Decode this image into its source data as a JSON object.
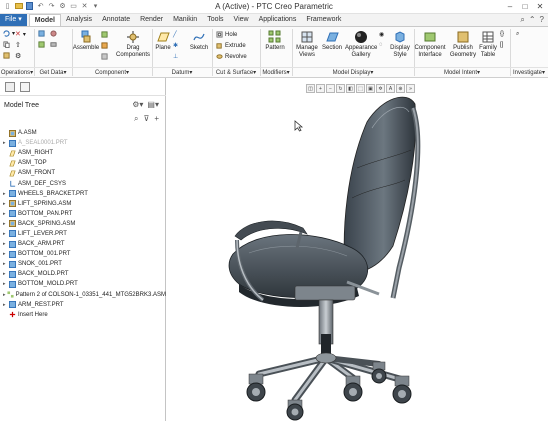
{
  "window": {
    "title": "A (Active) - PTC Creo Parametric"
  },
  "quick_access": [
    "new-icon",
    "open-icon",
    "save-icon",
    "undo-icon",
    "redo-icon",
    "regenerate-icon",
    "windows-icon",
    "close-icon",
    "dropdown-icon"
  ],
  "tabs": [
    "File",
    "Model",
    "Analysis",
    "Annotate",
    "Render",
    "Manikin",
    "Tools",
    "View",
    "Applications",
    "Framework"
  ],
  "active_tab": "Model",
  "ribbon": {
    "operations": {
      "label": "Operations"
    },
    "get_data": {
      "label": "Get Data"
    },
    "assemble": {
      "label": "Assemble"
    },
    "drag_components": {
      "label": "Drag Components"
    },
    "component": {
      "label": "Component"
    },
    "plane": {
      "label": "Plane"
    },
    "sketch": {
      "label": "Sketch"
    },
    "datum": {
      "label": "Datum"
    },
    "hole": {
      "label": "Hole"
    },
    "extrude": {
      "label": "Extrude"
    },
    "revolve": {
      "label": "Revolve"
    },
    "cut_surface": {
      "label": "Cut & Surface"
    },
    "pattern": {
      "label": "Pattern"
    },
    "modifiers": {
      "label": "Modifiers"
    },
    "manage_views": {
      "label": "Manage Views"
    },
    "section": {
      "label": "Section"
    },
    "appearance_gallery": {
      "label": "Appearance Gallery"
    },
    "display_style": {
      "label": "Display Style"
    },
    "model_display": {
      "label": "Model Display"
    },
    "component_interface": {
      "label": "Component Interface"
    },
    "publish_geometry": {
      "label": "Publish Geometry"
    },
    "family_table": {
      "label": "Family Table"
    },
    "model_intent": {
      "label": "Model Intent"
    },
    "investigate": {
      "label": "Investigate"
    }
  },
  "panel": {
    "title": "Model Tree"
  },
  "tree": [
    {
      "label": "A.ASM",
      "icon": "assembly",
      "expander": "",
      "dim": false
    },
    {
      "label": "A_SEAL0001.PRT",
      "icon": "part",
      "expander": "▸",
      "dim": true
    },
    {
      "label": "ASM_RIGHT",
      "icon": "plane",
      "expander": "",
      "dim": false
    },
    {
      "label": "ASM_TOP",
      "icon": "plane",
      "expander": "",
      "dim": false
    },
    {
      "label": "ASM_FRONT",
      "icon": "plane",
      "expander": "",
      "dim": false
    },
    {
      "label": "ASM_DEF_CSYS",
      "icon": "csys",
      "expander": "",
      "dim": false
    },
    {
      "label": "WHEELS_BRACKET.PRT",
      "icon": "part",
      "expander": "▸",
      "dim": false
    },
    {
      "label": "LIFT_SPRING.ASM",
      "icon": "assembly",
      "expander": "▸",
      "dim": false
    },
    {
      "label": "BOTTOM_PAN.PRT",
      "icon": "part",
      "expander": "▸",
      "dim": false
    },
    {
      "label": "BACK_SPRING.ASM",
      "icon": "assembly",
      "expander": "▸",
      "dim": false
    },
    {
      "label": "LIFT_LEVER.PRT",
      "icon": "part",
      "expander": "▸",
      "dim": false
    },
    {
      "label": "BACK_ARM.PRT",
      "icon": "part",
      "expander": "▸",
      "dim": false
    },
    {
      "label": "BOTTOM_001.PRT",
      "icon": "part",
      "expander": "▸",
      "dim": false
    },
    {
      "label": "SNOK_001.PRT",
      "icon": "part",
      "expander": "▸",
      "dim": false
    },
    {
      "label": "BACK_MOLD.PRT",
      "icon": "part",
      "expander": "▸",
      "dim": false
    },
    {
      "label": "BOTTOM_MOLD.PRT",
      "icon": "part",
      "expander": "▸",
      "dim": false
    },
    {
      "label": "Pattern 2 of COLSON-1_03351_441_MTG52BRK3.ASM",
      "icon": "pattern",
      "expander": "▸",
      "dim": false
    },
    {
      "label": "ARM_REST.PRT",
      "icon": "part",
      "expander": "▸",
      "dim": false
    },
    {
      "label": "Insert Here",
      "icon": "insert",
      "expander": "",
      "dim": false
    }
  ],
  "colors": {
    "file_tab": "#2f6fb6",
    "accent": "#2f6fb6",
    "chair_seat": "#46505a",
    "chair_frame": "#9aa1a8"
  }
}
